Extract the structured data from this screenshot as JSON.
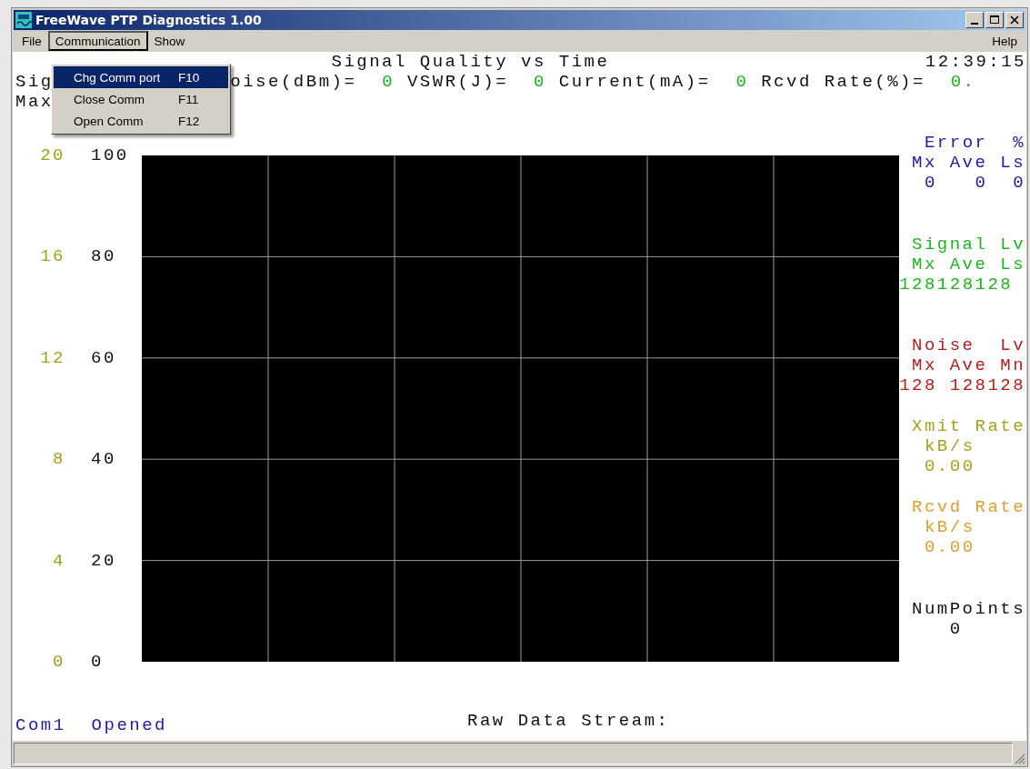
{
  "window": {
    "title": "FreeWave PTP Diagnostics 1.00"
  },
  "menu": [
    {
      "label": "File",
      "selected": false
    },
    {
      "label": "Communication",
      "selected": true
    },
    {
      "label": "Show",
      "selected": false
    }
  ],
  "help_menu": "Help",
  "dropdown": [
    {
      "label": "Chg Comm port",
      "shortcut": "F10",
      "selected": true
    },
    {
      "label": "Close Comm",
      "shortcut": "F11",
      "selected": false
    },
    {
      "label": "Open Comm",
      "shortcut": "F12",
      "selected": false
    }
  ],
  "header": {
    "title": "Signal Quality vs Time",
    "time": "12:39:15"
  },
  "readings": [
    {
      "text": "Sig",
      "kind": "label"
    },
    {
      "text": "oise(dBm)=",
      "kind": "label"
    },
    {
      "text": "0",
      "kind": "value"
    },
    {
      "text": "VSWR(J)=",
      "kind": "label"
    },
    {
      "text": "0",
      "kind": "value"
    },
    {
      "text": "Current(mA)=",
      "kind": "label"
    },
    {
      "text": "0",
      "kind": "value"
    },
    {
      "text": "Rcvd Rate(%)=",
      "kind": "label"
    },
    {
      "text": "0.",
      "kind": "value"
    }
  ],
  "line_3": "Max",
  "plot": {
    "left_ticks": [
      "20",
      "16",
      "12",
      "8",
      "4",
      "0"
    ],
    "right_ticks": [
      "100",
      "80",
      "60",
      "40",
      "20",
      "0"
    ]
  },
  "stats": [
    {
      "color": "#2020a0",
      "lines": [
        "Error  %",
        "Mx Ave Ls",
        "0   0  0"
      ]
    },
    {
      "color": "#20b020",
      "lines": [
        "Signal Lv",
        "Mx Ave Ls",
        "128128128"
      ]
    },
    {
      "color": "#b02020",
      "lines": [
        "Noise  Lv",
        "Mx Ave Mn",
        "128 128128"
      ]
    },
    {
      "color": "#a8a020",
      "lines": [
        "Xmit Rate",
        "kB/s",
        "0.00"
      ]
    },
    {
      "color": "#d8a030",
      "lines": [
        "Rcvd Rate",
        "kB/s",
        "0.00"
      ]
    },
    {
      "color": "#101010",
      "lines": [
        "NumPoints",
        "0"
      ]
    }
  ],
  "port": "Com1",
  "port_status": "Opened",
  "raw_data_label": "Raw Data Stream:"
}
